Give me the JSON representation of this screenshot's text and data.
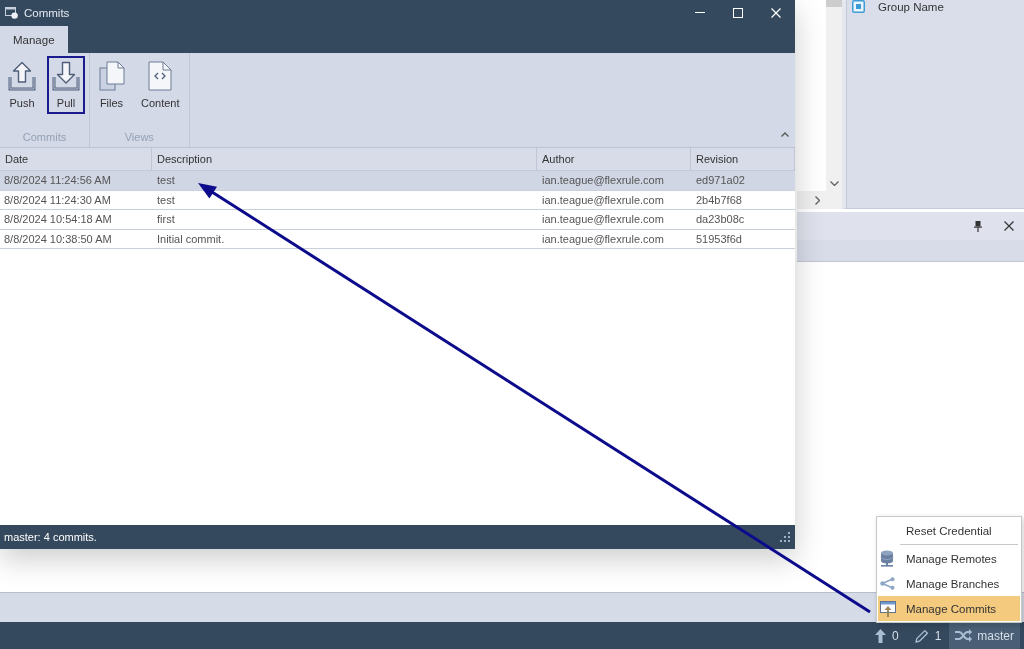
{
  "commits_window": {
    "title": "Commits",
    "tabs": [
      {
        "label": "Manage",
        "selected": true
      }
    ],
    "ribbon": {
      "groups": [
        {
          "label": "Commits",
          "buttons": [
            {
              "label": "Push",
              "focused": false
            },
            {
              "label": "Pull",
              "focused": true
            }
          ]
        },
        {
          "label": "Views",
          "buttons": [
            {
              "label": "Files",
              "focused": false
            },
            {
              "label": "Content",
              "focused": false
            }
          ]
        }
      ]
    },
    "table": {
      "columns": [
        "Date",
        "Description",
        "Author",
        "Revision"
      ],
      "rows": [
        {
          "selected": true,
          "cells": [
            "8/8/2024 11:24:56 AM",
            "test",
            "ian.teague@flexrule.com",
            "ed971a02"
          ]
        },
        {
          "selected": false,
          "cells": [
            "8/8/2024 11:24:30 AM",
            "test",
            "ian.teague@flexrule.com",
            "2b4b7f68"
          ]
        },
        {
          "selected": false,
          "cells": [
            "8/8/2024 10:54:18 AM",
            "first",
            "ian.teague@flexrule.com",
            "da23b08c"
          ]
        },
        {
          "selected": false,
          "cells": [
            "8/8/2024 10:38:50 AM",
            "Initial commit.",
            "ian.teague@flexrule.com",
            "51953f6d"
          ]
        }
      ]
    },
    "status_bar": {
      "text": "master: 4 commits."
    }
  },
  "side_panel": {
    "items": [
      {
        "label": "Group Name"
      }
    ]
  },
  "context_menu": {
    "items": [
      {
        "kind": "action",
        "label": "Reset Credential",
        "selected": false
      },
      {
        "kind": "separator"
      },
      {
        "kind": "action",
        "label": "Manage Remotes",
        "selected": false
      },
      {
        "kind": "action",
        "label": "Manage Branches",
        "selected": false
      },
      {
        "kind": "action",
        "label": "Manage Commits",
        "selected": true
      }
    ]
  },
  "status_bar": {
    "items": [
      {
        "kind": "counter",
        "text": "0"
      },
      {
        "kind": "counter",
        "text": "1"
      },
      {
        "kind": "branch",
        "text": "master"
      }
    ]
  }
}
